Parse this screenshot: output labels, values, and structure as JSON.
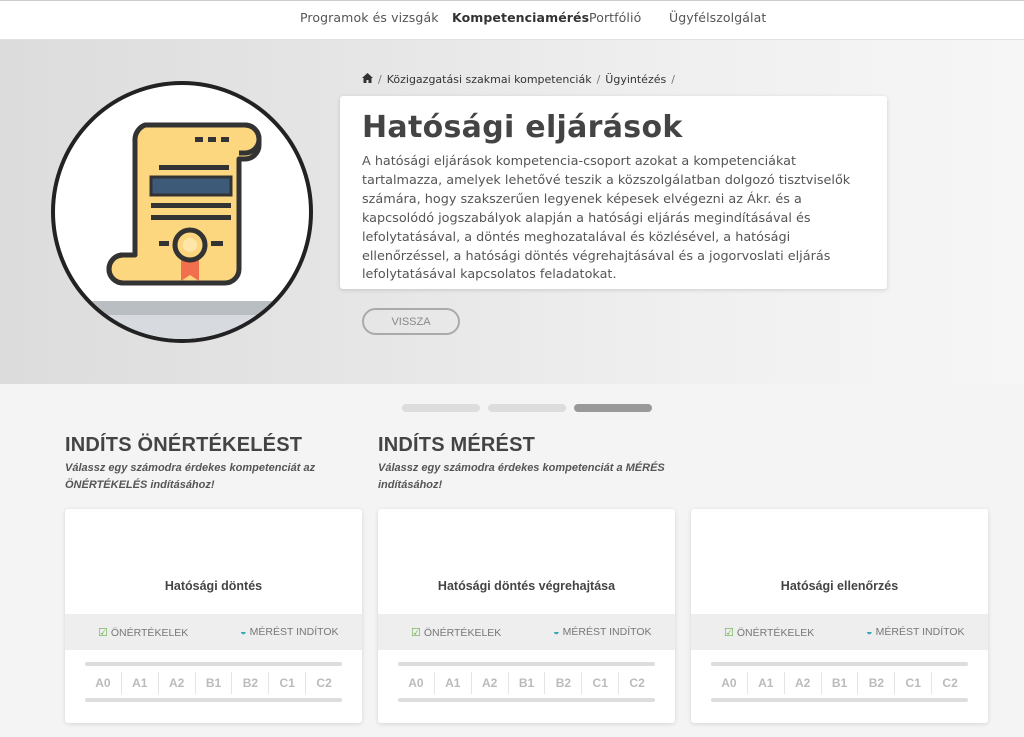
{
  "nav": {
    "items": [
      "Programok és vizsgák",
      "Kompetenciamérés",
      "Portfólió",
      "Ügyfélszolgálat"
    ],
    "active_index": 1
  },
  "breadcrumb": {
    "home_icon": "home-icon",
    "items": [
      "Közigazgatási szakmai kompetenciák",
      "Ügyintézés"
    ]
  },
  "main": {
    "title": "Hatósági eljárások",
    "description": "A hatósági eljárások kompetencia-csoport azokat a kompetenciákat tartalmazza, amelyek lehetővé teszik a közszolgálatban dolgozó tisztviselők számára, hogy szakszerűen legyenek képesek elvégezni az Ákr. és a kapcsolódó jogszabályok alapján a hatósági eljárás megindításával és lefolytatásával, a döntés meghozatalával és közlésével, a hatósági ellenőrzéssel, a hatósági döntés végrehajtásával és a jogorvoslati eljárás lefolytatásával kapcsolatos feladatokat.",
    "back_label": "VISSZA",
    "illustration_icon": "scroll-certificate-icon"
  },
  "carousel": {
    "count": 3,
    "active_index": 2
  },
  "sections": {
    "self": {
      "title": "INDÍTS ÖNÉRTÉKELÉST",
      "subtitle_line1": "Válassz egy számodra érdekes kompetenciát az",
      "subtitle_line2": "ÖNÉRTÉKELÉS indításához!"
    },
    "measure": {
      "title": "INDÍTS MÉRÉST",
      "subtitle_line1": "Válassz egy számodra érdekes kompetenciát a MÉRÉS",
      "subtitle_line2": "indításához!"
    }
  },
  "cards": [
    {
      "title": "Hatósági döntés",
      "self_label": "ÖNÉRTÉKELEK",
      "measure_label": "MÉRÉST INDÍTOK"
    },
    {
      "title": "Hatósági döntés végrehajtása",
      "self_label": "ÖNÉRTÉKELEK",
      "measure_label": "MÉRÉST INDÍTOK"
    },
    {
      "title": "Hatósági ellenőrzés",
      "self_label": "ÖNÉRTÉKELEK",
      "measure_label": "MÉRÉST INDÍTOK"
    }
  ],
  "levels": [
    "A0",
    "A1",
    "A2",
    "B1",
    "B2",
    "C1",
    "C2"
  ],
  "colors": {
    "accent_check": "#6ab04c",
    "accent_gauge": "#3ba8b8",
    "scroll_paper": "#fcd77f",
    "scroll_band": "#3d5a78",
    "ribbon": "#f26f4d"
  }
}
